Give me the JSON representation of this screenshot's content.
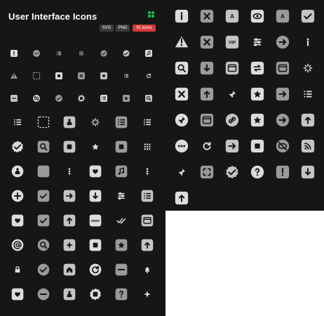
{
  "header": {
    "title": "User Interface Icons",
    "badges": {
      "svg": "SVG",
      "png": "PNG",
      "count": "91 icons"
    }
  },
  "colors": {
    "background": "#161616",
    "icon_light": "#dcdcdc",
    "icon_mid": "#9a9a9a",
    "icon_dark": "#5a5a5a",
    "badge_dark": "#3a3a3a",
    "badge_red": "#d83a3a",
    "logo_green": "#1db954"
  },
  "icons": {
    "small_grid": [
      "thermometer-icon",
      "search-dots-icon",
      "list-icon",
      "grid-dots-icon",
      "check-badge-icon",
      "check-seal-icon",
      "music-note-icon",
      "warning-icon",
      "dashed-selection-icon",
      "layers-icon",
      "close-box-icon",
      "folder-heart-icon",
      "list-search-icon",
      "refresh-icon",
      "minimize-window-icon",
      "eye-off-icon",
      "check-circle-dashed-icon",
      "settings-gear-icon",
      "book-icon",
      "image-icon",
      "search-window-icon"
    ],
    "left_large_grid": [
      "list-icon",
      "dashed-selection-icon",
      "user-card-icon",
      "loading-spinner-icon",
      "flow-chart-icon",
      "list-icon",
      "check-badge-icon",
      "folder-search-icon",
      "stop-button-icon",
      "star-icon",
      "floppy-disk-icon",
      "grid-dots-icon",
      "user-figure-icon",
      "square-icon",
      "more-vertical-icon",
      "hand-stop-icon",
      "music-note-icon",
      "more-vertical-icon",
      "plus-circle-icon",
      "save-check-icon",
      "arrow-right-box-icon",
      "download-box-icon",
      "sliders-icon",
      "clipboard-list-icon",
      "folder-heart-icon",
      "check-square-icon",
      "upload-window-icon",
      "www-icon",
      "double-check-icon",
      "toggle-off-icon",
      "at-sign-icon",
      "lifebuoy-icon",
      "diamond-stack-icon",
      "copy-icon",
      "image-icon",
      "upload-box-icon",
      "lock-icon",
      "check-circle-dashed-icon",
      "home-icon",
      "refresh-check-icon",
      "minimize-icon",
      "bell-icon",
      "cloud-folder-icon",
      "minus-circle-icon",
      "stamp-icon",
      "settings-gear-icon",
      "help-file-icon",
      "sparkle-icon"
    ],
    "right_grid": [
      "info-book-icon",
      "close-box-icon",
      "translate-icon",
      "eye-icon",
      "language-icon",
      "check-arrow-icon",
      "warning-icon",
      "trash-icon",
      "vip-icon",
      "sliders-icon",
      "arrow-right-circle-icon",
      "info-icon",
      "search-box-icon",
      "download-box-icon",
      "cards-icon",
      "swap-icon",
      "browser-window-icon",
      "loading-dots-icon",
      "backspace-icon",
      "arrow-up-box-icon",
      "pin-icon",
      "image-icon",
      "arrow-right-square-icon",
      "list-search-icon",
      "pin-circle-icon",
      "browser-settings-icon",
      "link-icon",
      "photos-icon",
      "arrow-right-circle-icon",
      "arrow-up-box-icon",
      "more-horizontal-icon",
      "refresh-icon",
      "sidebar-arrow-icon",
      "save-edit-icon",
      "eye-off-icon",
      "rss-icon",
      "pin-icon",
      "fullscreen-icon",
      "check-badge-icon",
      "help-circle-icon",
      "thermometer-icon",
      "download-box-icon",
      "upload-tray-icon"
    ]
  }
}
